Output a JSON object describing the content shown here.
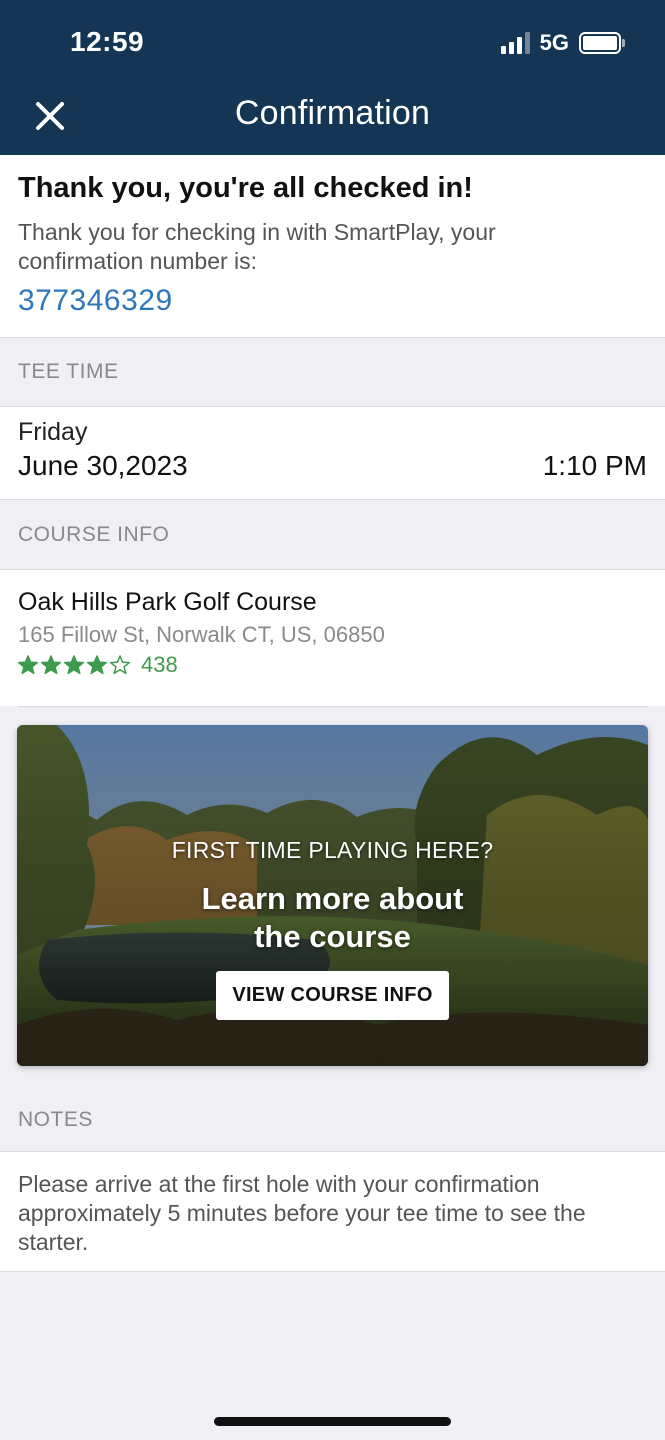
{
  "status_bar": {
    "time": "12:59",
    "network": "5G"
  },
  "nav": {
    "title": "Confirmation"
  },
  "confirmation": {
    "title": "Thank you, you're all checked in!",
    "body": "Thank you for checking in with SmartPlay, your confirmation number is:",
    "number": "377346329"
  },
  "tee_time": {
    "header": "TEE TIME",
    "day": "Friday",
    "date": "June 30,2023",
    "time": "1:10 PM"
  },
  "course_info": {
    "header": "COURSE INFO",
    "name": "Oak Hills Park Golf Course",
    "address": "165 Fillow St, Norwalk CT, US, 06850",
    "rating": 4,
    "rating_max": 5,
    "review_count": "438"
  },
  "promo": {
    "kicker": "FIRST TIME PLAYING HERE?",
    "title_line1": "Learn more about",
    "title_line2": "the course",
    "button": "VIEW COURSE INFO"
  },
  "notes": {
    "header": "NOTES",
    "text": "Please arrive at the first hole with your confirmation approximately 5 minutes before your tee time to see the starter."
  },
  "colors": {
    "nav_bg": "#143553",
    "link": "#2f76bb",
    "rating": "#3e9b4e"
  }
}
